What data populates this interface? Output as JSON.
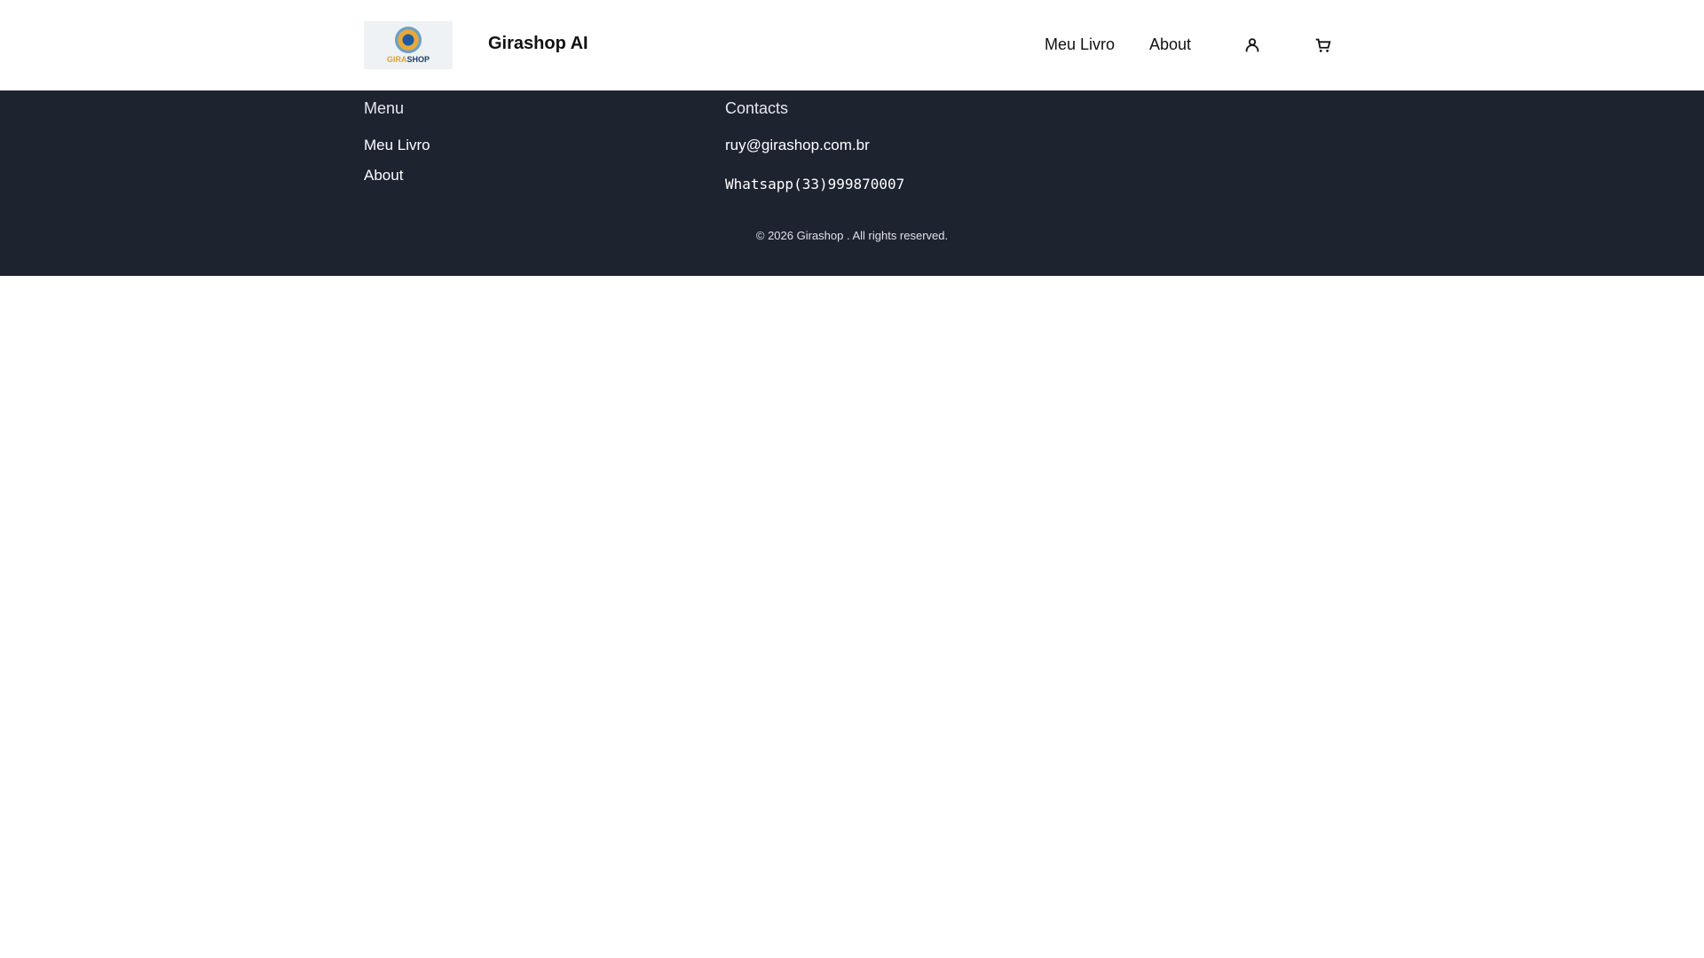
{
  "header": {
    "logo_text_a": "GIRA",
    "logo_text_b": "SHOP",
    "title": "Girashop AI",
    "nav": [
      "Meu Livro",
      "About"
    ]
  },
  "footer": {
    "menu_heading": "Menu",
    "menu_items": [
      "Meu Livro",
      "About"
    ],
    "contacts_heading": "Contacts",
    "email": "ruy@girashop.com.br",
    "whatsapp": "Whatsapp(33)999870007",
    "copyright": "© 2026 Girashop . All rights reserved."
  }
}
